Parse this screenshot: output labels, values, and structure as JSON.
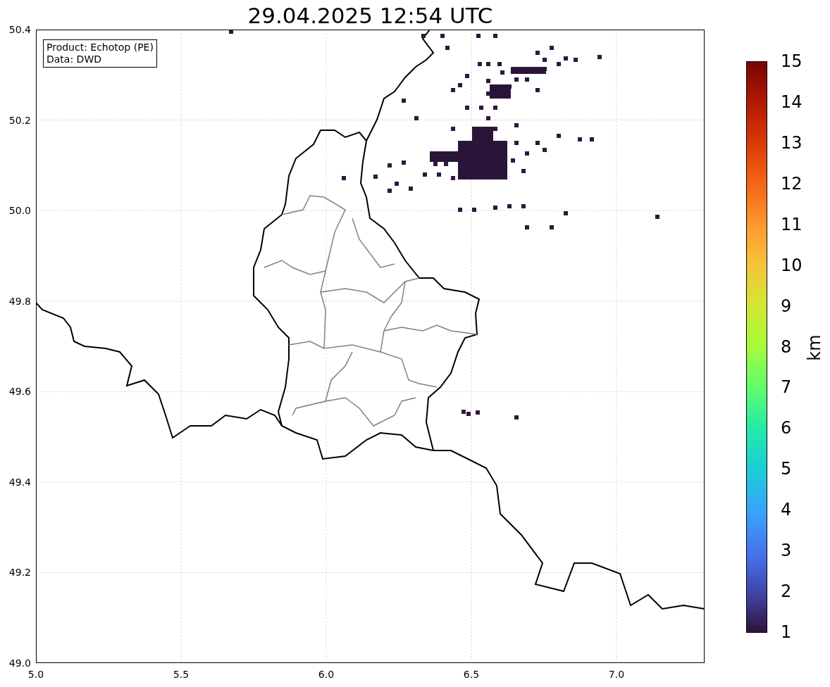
{
  "title": "29.04.2025 12:54 UTC",
  "info_box": [
    "Product: Echotop (PE)",
    "Data: DWD"
  ],
  "x_ticks": [
    "5.0",
    "5.5",
    "6.0",
    "6.5",
    "7.0"
  ],
  "y_ticks": [
    "50.4",
    "50.2",
    "50.0",
    "49.8",
    "49.6",
    "49.4",
    "49.2",
    "49.0"
  ],
  "colorbar": {
    "label": "km",
    "ticks": [
      "15",
      "14",
      "13",
      "12",
      "11",
      "10",
      "9",
      "8",
      "7",
      "6",
      "5",
      "4",
      "3",
      "2",
      "1"
    ]
  }
}
